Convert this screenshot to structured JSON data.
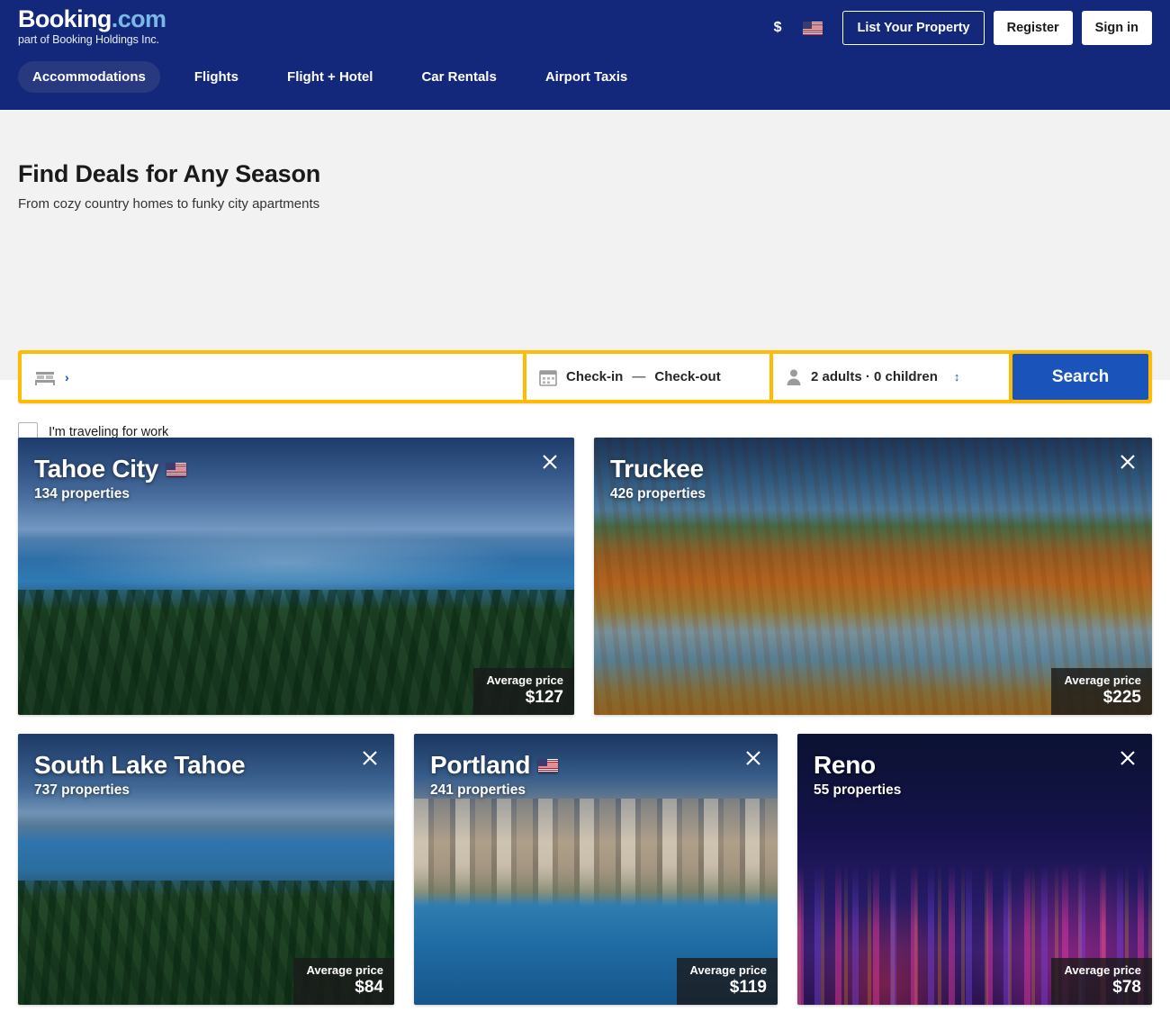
{
  "header": {
    "logo_primary": "Booking",
    "logo_secondary": ".com",
    "tagline": "part of Booking Holdings Inc.",
    "currency_symbol": "$",
    "language_icon": "us-flag-icon",
    "list_property_label": "List Your Property",
    "register_label": "Register",
    "signin_label": "Sign in",
    "brand_blue": "#13287b",
    "nav": [
      {
        "label": "Accommodations",
        "active": true
      },
      {
        "label": "Flights",
        "active": false
      },
      {
        "label": "Flight + Hotel",
        "active": false
      },
      {
        "label": "Car Rentals",
        "active": false
      },
      {
        "label": "Airport Taxis",
        "active": false
      }
    ]
  },
  "hero": {
    "title": "Find Deals for Any Season",
    "subtitle": "From cozy country homes to funky city apartments",
    "accent_orange": "#febb02",
    "search": {
      "destination_value": "",
      "destination_placeholder": "",
      "destination_chevron": "›",
      "checkin_label": "Check-in",
      "date_dash": "—",
      "checkout_label": "Check-out",
      "guests_value": "2 adults · 0 children",
      "search_button_label": "Search",
      "search_button_color": "#1a54bb"
    },
    "work_checkbox": {
      "label": "I'm traveling for work",
      "checked": false
    }
  },
  "destinations": {
    "row1": [
      {
        "name": "Tahoe City",
        "properties": "134 properties",
        "flag": true,
        "price_label": "Average price",
        "price_value": "$127",
        "scene": "ph-tahoe"
      },
      {
        "name": "Truckee",
        "properties": "426 properties",
        "flag": false,
        "price_label": "Average price",
        "price_value": "$225",
        "scene": "ph-truckee"
      }
    ],
    "row2": [
      {
        "name": "South Lake Tahoe",
        "properties": "737 properties",
        "flag": false,
        "price_label": "Average price",
        "price_value": "$84",
        "scene": "ph-slt"
      },
      {
        "name": "Portland",
        "properties": "241 properties",
        "flag": true,
        "price_label": "Average price",
        "price_value": "$119",
        "scene": "ph-portland"
      },
      {
        "name": "Reno",
        "properties": "55 properties",
        "flag": false,
        "price_label": "Average price",
        "price_value": "$78",
        "scene": "ph-reno"
      }
    ]
  }
}
